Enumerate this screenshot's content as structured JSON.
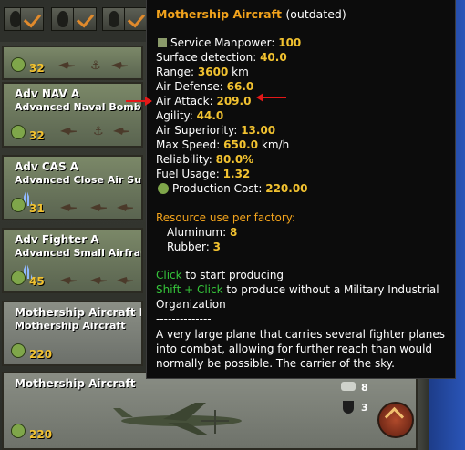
{
  "cards": [
    {
      "title": "",
      "subtitle": "",
      "cost": "32"
    },
    {
      "title": "Adv NAV A",
      "subtitle": "Advanced Naval Bomber",
      "cost": "32"
    },
    {
      "title": "Adv CAS A",
      "subtitle": "Advanced Close Air Support",
      "cost": "31"
    },
    {
      "title": "Adv Fighter A",
      "subtitle": "Advanced Small Airframe",
      "cost": "45"
    },
    {
      "title": "Mothership Aircraft I",
      "subtitle": "Mothership Aircraft",
      "cost": "220"
    }
  ],
  "big_row": {
    "title": "Mothership Aircraft",
    "cost": "220",
    "stat_1": "8",
    "stat_2": "3"
  },
  "tooltip": {
    "name": "Mothership Aircraft",
    "status": "(outdated)",
    "stats": [
      {
        "label": "Service Manpower:",
        "value": "100"
      },
      {
        "label": "Surface detection:",
        "value": "40.0"
      },
      {
        "label": "Range:",
        "value": "3600",
        "unit": "km"
      },
      {
        "label": "Air Defense:",
        "value": "66.0"
      },
      {
        "label": "Air Attack:",
        "value": "209.0"
      },
      {
        "label": "Agility:",
        "value": "44.0"
      },
      {
        "label": "Air Superiority:",
        "value": "13.00"
      },
      {
        "label": "Max Speed:",
        "value": "650.0",
        "unit": "km/h"
      },
      {
        "label": "Reliability:",
        "value": "80.0%"
      },
      {
        "label": "Fuel Usage:",
        "value": "1.32"
      },
      {
        "label": "Production Cost:",
        "value": "220.00"
      }
    ],
    "resource_header": "Resource use per factory:",
    "resources": [
      {
        "label": "Aluminum:",
        "value": "8"
      },
      {
        "label": "Rubber:",
        "value": "3"
      }
    ],
    "click_key": "Click",
    "click_text": "to start producing",
    "shift_key": "Shift + Click",
    "shift_text": "to produce without a Military Industrial",
    "shift_text_2": "Organization",
    "separator": "--------------",
    "description": "A very large plane that carries several fighter planes into combat, allowing for further reach than would normally be possible. The carrier of the sky."
  },
  "colors": {
    "accent": "#f2a31c",
    "value": "#f2c230",
    "shortcut": "#35c43a",
    "annotation_arrow": "#e41818"
  }
}
